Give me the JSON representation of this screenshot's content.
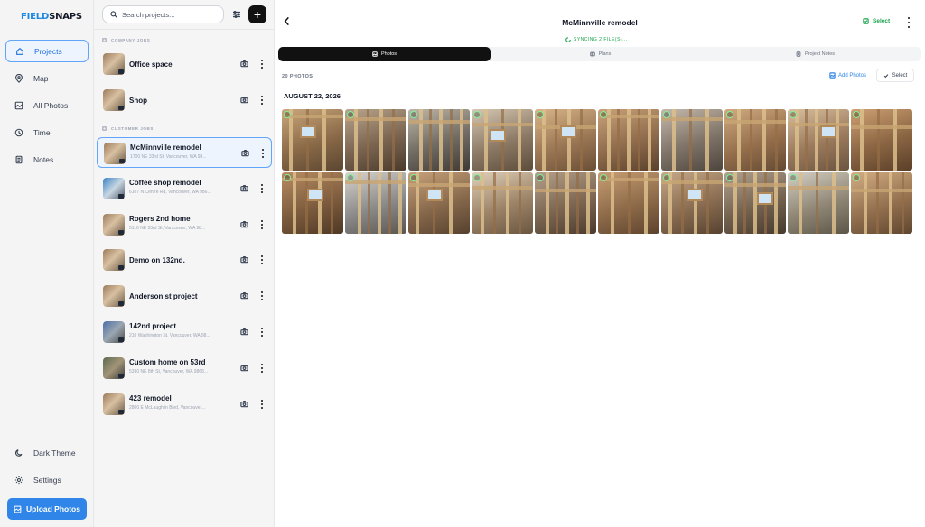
{
  "app": {
    "logo_part1": "FIELD",
    "logo_part2": "SNAPS"
  },
  "nav": {
    "items": [
      {
        "label": "Projects",
        "icon": "home-icon",
        "active": true
      },
      {
        "label": "Map",
        "icon": "map-pin-icon"
      },
      {
        "label": "All Photos",
        "icon": "photos-icon"
      },
      {
        "label": "Time",
        "icon": "clock-icon"
      },
      {
        "label": "Notes",
        "icon": "notes-icon"
      }
    ],
    "dark_theme": "Dark Theme",
    "settings": "Settings",
    "upload": "Upload Photos"
  },
  "list": {
    "search_placeholder": "Search projects...",
    "groups": {
      "company": "COMPANY JOBS",
      "customer": "CUSTOMER JOBS"
    },
    "projects": [
      {
        "name": "Office space",
        "address": ""
      },
      {
        "name": "Shop",
        "address": ""
      },
      {
        "name": "McMinnville remodel",
        "address": "1700 NE 33rd St, Vancouver, WA 98...",
        "active": true
      },
      {
        "name": "Coffee shop remodel",
        "address": "6107 N Centre Rd, Vancouver, WA 986..."
      },
      {
        "name": "Rogers 2nd home",
        "address": "5110 NE 33rd St, Vancouver, WA 98..."
      },
      {
        "name": "Demo on 132nd.",
        "address": ""
      },
      {
        "name": "Anderson st project",
        "address": ""
      },
      {
        "name": "142nd project",
        "address": "210 Washington St, Vancouver, WA 98..."
      },
      {
        "name": "Custom home on 53rd",
        "address": "5330 NE 8th St, Vancouver, WA 9868..."
      },
      {
        "name": "423 remodel",
        "address": "2800 E McLaughlin Blvd, Vancouver..."
      }
    ]
  },
  "main": {
    "title": "McMinnville remodel",
    "sync_status": "SYNCING 2 FILE(S)...",
    "select_label": "Select",
    "tabs": [
      {
        "label": "Photos",
        "icon": "photo-icon",
        "active": true
      },
      {
        "label": "Plans",
        "icon": "plans-icon"
      },
      {
        "label": "Project Notes",
        "icon": "notes-icon"
      }
    ],
    "photo_count": "20 PHOTOS",
    "add_photos": "Add Photos",
    "select_button": "Select",
    "date": "AUGUST 22, 2026"
  },
  "colors": {
    "accent": "#2f86e8",
    "sync": "#16a34a",
    "active_border": "#60a5fa"
  }
}
